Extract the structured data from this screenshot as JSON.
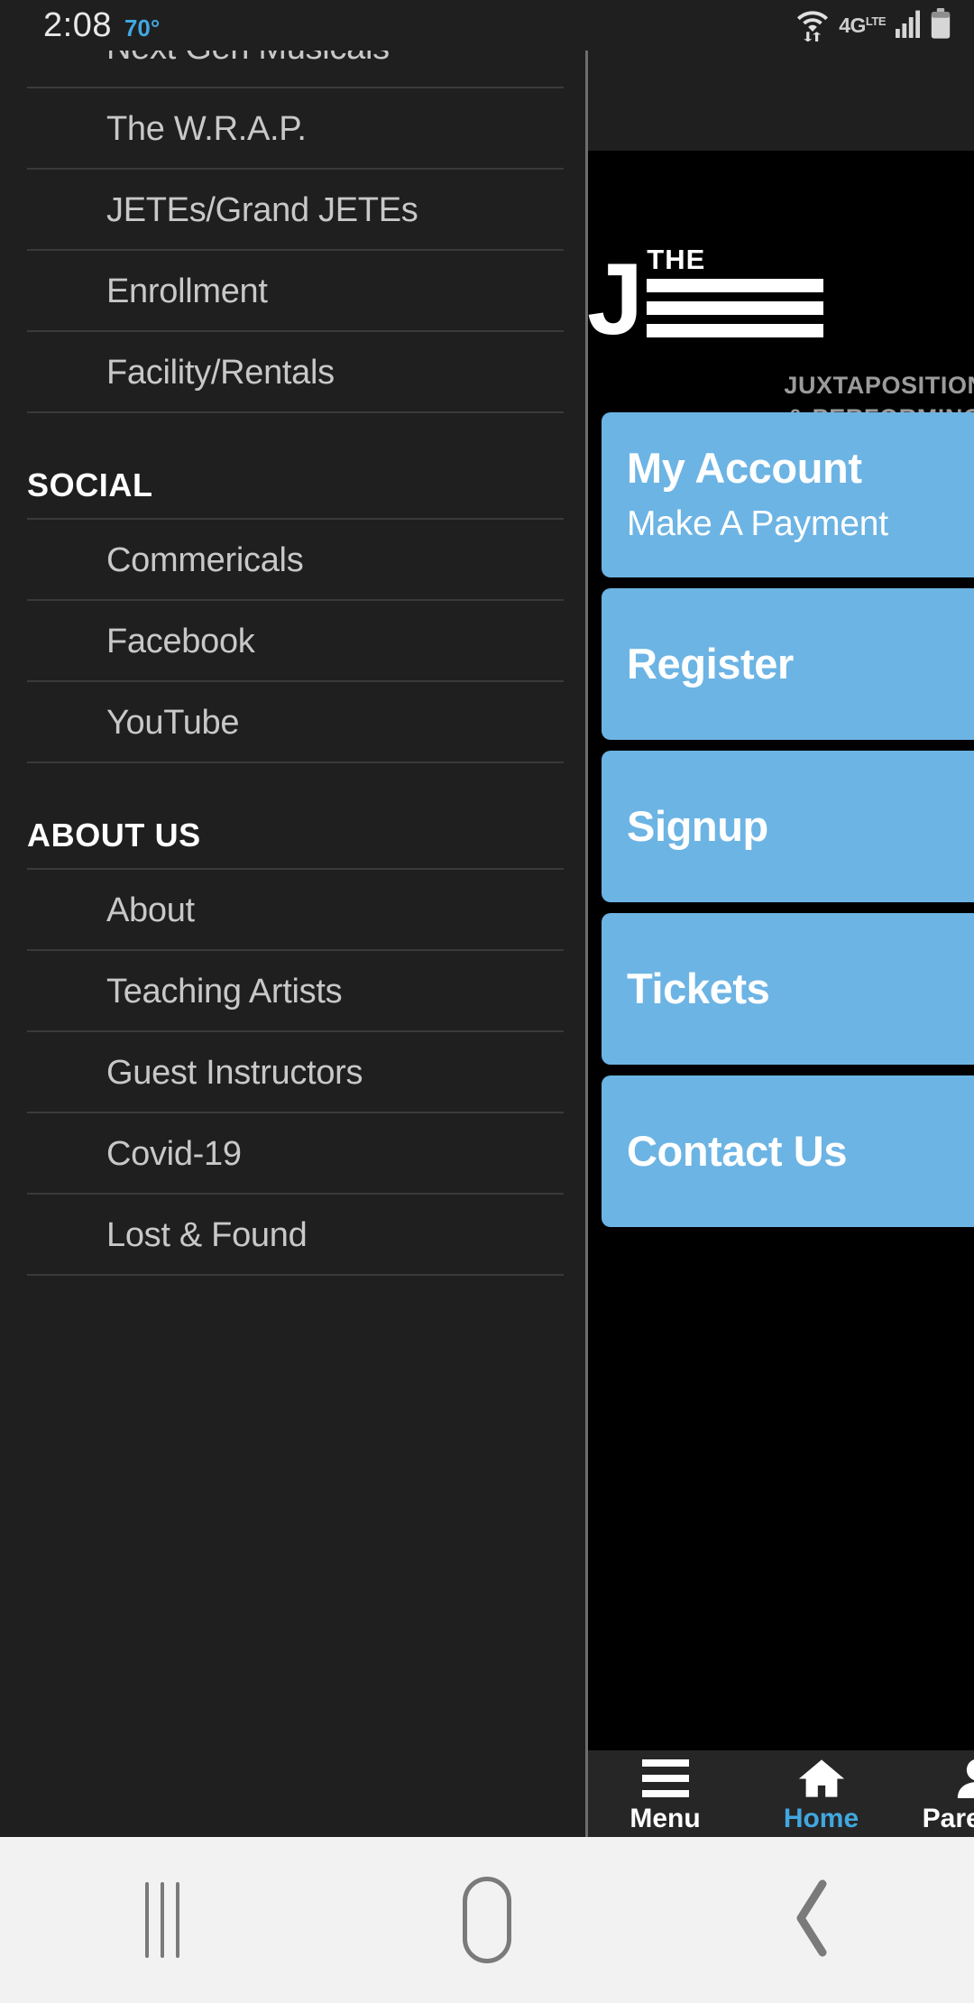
{
  "status_bar": {
    "time": "2:08",
    "temperature": "70°",
    "icons": [
      "wifi-data-icon",
      "4g-lte-icon",
      "cellular-signal-icon",
      "battery-icon"
    ],
    "network_label": "4G",
    "network_sup": "LTE"
  },
  "drawer": {
    "items": [
      {
        "label": "Next Gen Musicals",
        "type": "link"
      },
      {
        "label": "The W.R.A.P.",
        "type": "link"
      },
      {
        "label": "JETEs/Grand JETEs",
        "type": "link"
      },
      {
        "label": "Enrollment",
        "type": "link"
      },
      {
        "label": "Facility/Rentals",
        "type": "link"
      },
      {
        "label": "SOCIAL",
        "type": "header"
      },
      {
        "label": "Commericals",
        "type": "link"
      },
      {
        "label": "Facebook",
        "type": "link"
      },
      {
        "label": "YouTube",
        "type": "link"
      },
      {
        "label": "ABOUT US",
        "type": "header"
      },
      {
        "label": "About",
        "type": "link"
      },
      {
        "label": "Teaching Artists",
        "type": "link"
      },
      {
        "label": "Guest Instructors",
        "type": "link"
      },
      {
        "label": "Covid-19",
        "type": "link"
      },
      {
        "label": "Lost & Found",
        "type": "link"
      }
    ]
  },
  "content": {
    "logo": {
      "letter": "J",
      "word": "THE",
      "bar_count": 3
    },
    "tagline": "JUXTAPOSITION\n& PERFORMING",
    "cards": [
      {
        "title": "My Account",
        "subtitle": "Make A Payment"
      },
      {
        "title": "Register",
        "subtitle": ""
      },
      {
        "title": "Signup",
        "subtitle": ""
      },
      {
        "title": "Tickets",
        "subtitle": ""
      },
      {
        "title": "Contact Us",
        "subtitle": ""
      }
    ]
  },
  "app_navbar": {
    "items": [
      {
        "label": "Menu",
        "icon": "hamburger-icon",
        "active": false
      },
      {
        "label": "Home",
        "icon": "home-icon",
        "active": true
      },
      {
        "label": "Parent P",
        "icon": "person-icon",
        "active": false
      }
    ]
  },
  "system_nav": {
    "buttons": [
      {
        "name": "recents",
        "icon": "recents-icon"
      },
      {
        "name": "home",
        "icon": "home-square-icon"
      },
      {
        "name": "back",
        "icon": "back-chevron-icon"
      }
    ]
  },
  "colors": {
    "accent_blue": "#41a7e0",
    "card_blue": "#6cb4e4",
    "drawer_bg": "#1f1f1f",
    "content_bg": "#000000",
    "system_nav_bg": "#f2f2f2"
  }
}
